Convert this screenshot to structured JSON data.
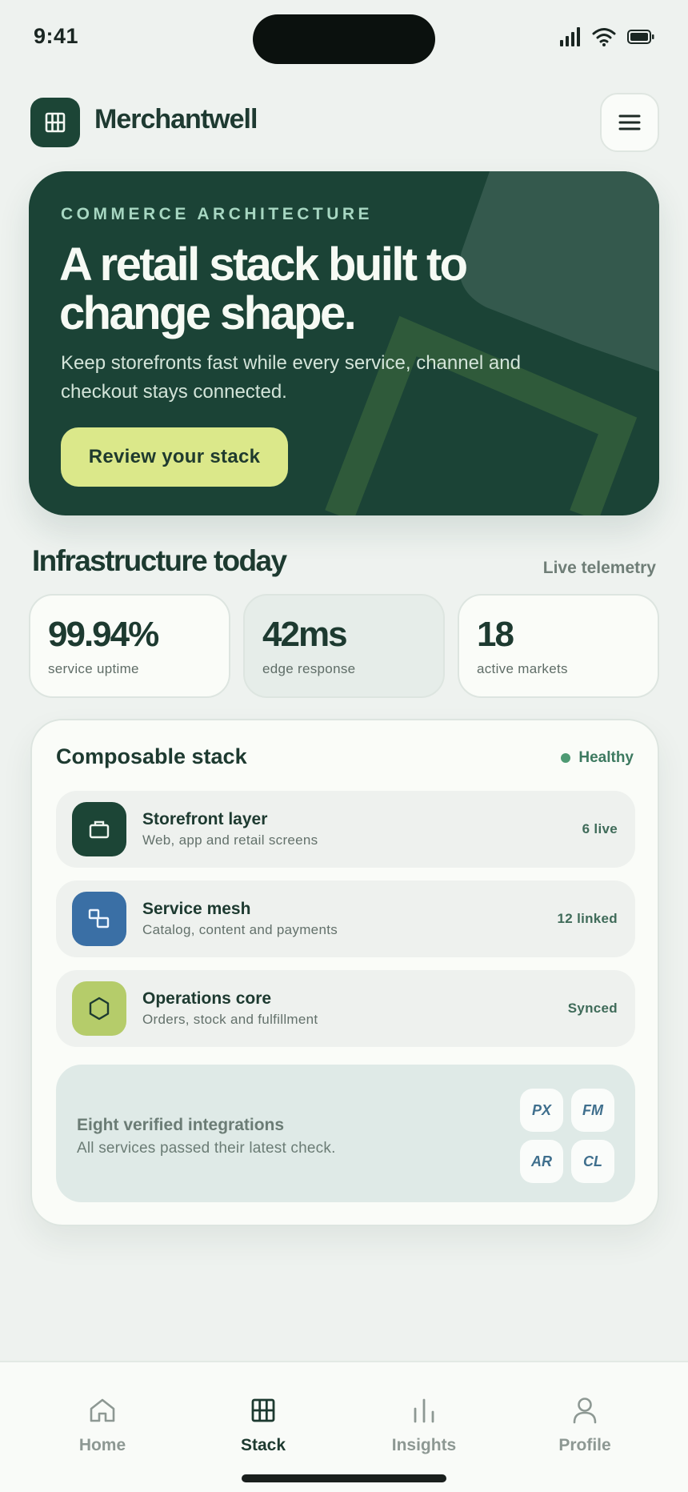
{
  "status_bar": {
    "time": "9:41"
  },
  "header": {
    "brand": "Merchantwell"
  },
  "hero": {
    "eyebrow": "COMMERCE ARCHITECTURE",
    "title": "A retail stack built to change shape.",
    "subtitle": "Keep storefronts fast while every service, channel and checkout stays connected.",
    "cta_label": "Review your stack"
  },
  "infrastructure": {
    "title": "Infrastructure today",
    "meta": "Live telemetry",
    "stats": [
      {
        "value": "99.94%",
        "label": "service uptime"
      },
      {
        "value": "42ms",
        "label": "edge response"
      },
      {
        "value": "18",
        "label": "active markets"
      }
    ]
  },
  "stack": {
    "title": "Composable stack",
    "status": "Healthy",
    "layers": [
      {
        "name": "Storefront layer",
        "desc": "Web, app and retail screens",
        "tag": "6 live",
        "icon": "storefront-icon",
        "color": "#1c4536"
      },
      {
        "name": "Service mesh",
        "desc": "Catalog, content and payments",
        "tag": "12 linked",
        "icon": "mesh-icon",
        "color": "#3a6fa5"
      },
      {
        "name": "Operations core",
        "desc": "Orders, stock and fulfillment",
        "tag": "Synced",
        "icon": "hexagon-icon",
        "color": "#b5cc6a"
      }
    ],
    "integrations": {
      "title": "Eight verified integrations",
      "subtitle": "All services passed their latest check.",
      "chips": [
        "PX",
        "FM",
        "AR",
        "CL"
      ]
    }
  },
  "tabbar": {
    "tabs": [
      {
        "label": "Home",
        "icon": "home-icon",
        "active": false
      },
      {
        "label": "Stack",
        "icon": "grid-icon",
        "active": true
      },
      {
        "label": "Insights",
        "icon": "bar-chart-icon",
        "active": false
      },
      {
        "label": "Profile",
        "icon": "person-icon",
        "active": false
      }
    ]
  },
  "colors": {
    "primary": "#1b4336",
    "accent": "#dbe88a",
    "background": "#eef2ef"
  }
}
